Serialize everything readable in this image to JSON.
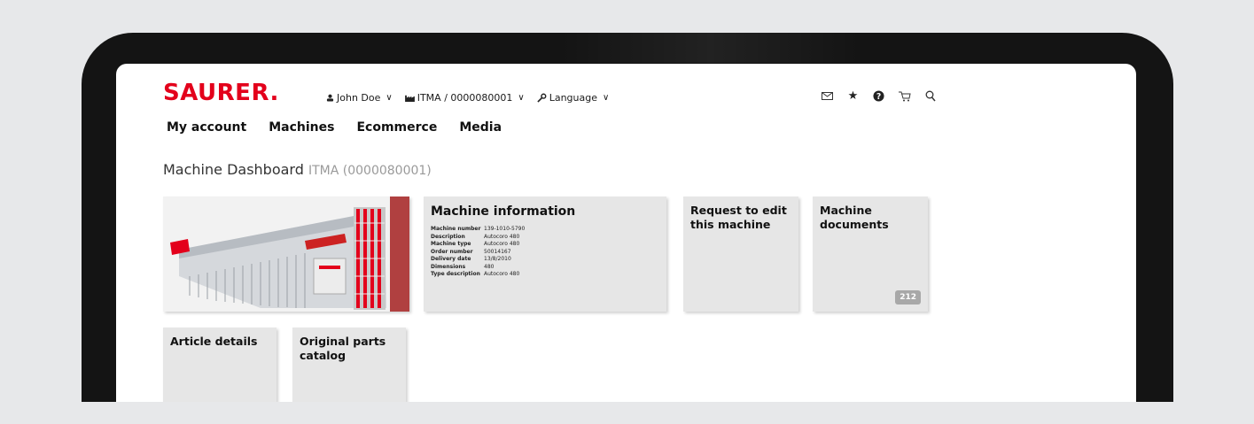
{
  "brand": {
    "logo": "SAURER.",
    "accent": "#e3001b"
  },
  "topbar": {
    "user": "John Doe",
    "machine_selector": "ITMA / 0000080001",
    "language": "Language",
    "icons": [
      "mail-icon",
      "star-icon",
      "help-icon",
      "cart-icon",
      "search-icon"
    ]
  },
  "nav": [
    "My account",
    "Machines",
    "Ecommerce",
    "Media"
  ],
  "page": {
    "title": "Machine Dashboard",
    "subtitle": "ITMA (0000080001)"
  },
  "machine_info": {
    "title": "Machine information",
    "rows": [
      {
        "key": "Machine number",
        "value": "139-1010-5790"
      },
      {
        "key": "Description",
        "value": "Autocoro 480"
      },
      {
        "key": "Machine type",
        "value": "Autocoro 480"
      },
      {
        "key": "Order number",
        "value": "50014167"
      },
      {
        "key": "Delivery date",
        "value": "13/8/2010"
      },
      {
        "key": "Dimensions",
        "value": "480"
      },
      {
        "key": "Type description",
        "value": "Autocoro 480"
      }
    ]
  },
  "tiles": {
    "edit": "Request to edit\nthis machine",
    "docs": "Machine\ndocuments",
    "docs_count": "212",
    "article": "Article details",
    "catalog": "Original parts\ncatalog"
  }
}
